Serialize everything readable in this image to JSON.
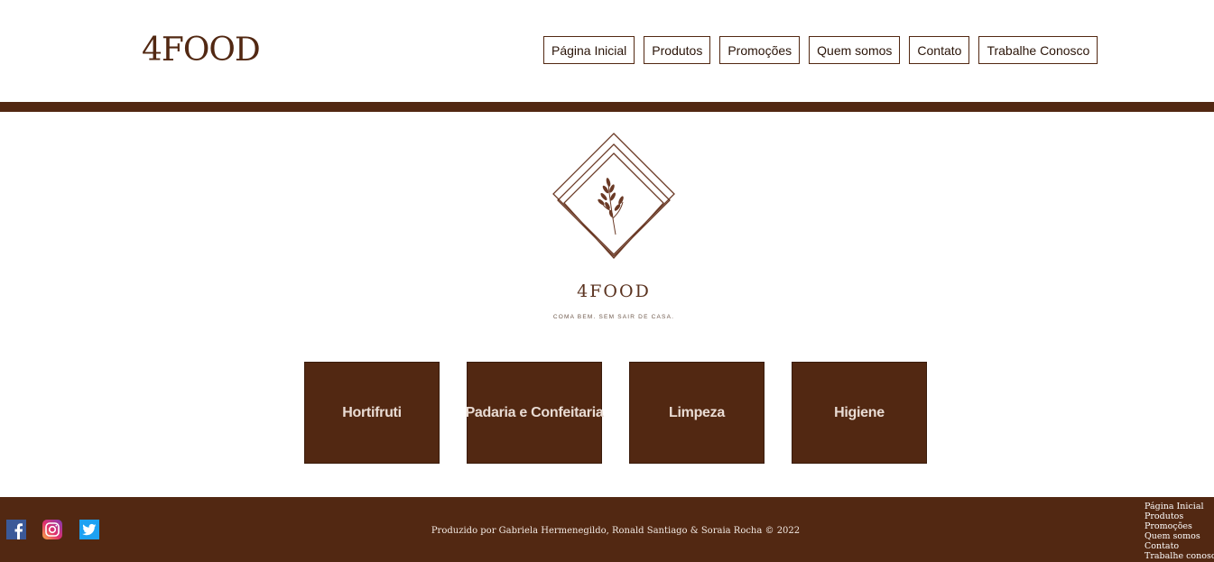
{
  "header": {
    "brand": "4FOOD",
    "nav": [
      "Página Inicial",
      "Produtos",
      "Promoções",
      "Quem somos",
      "Contato",
      "Trabalhe Conosco"
    ]
  },
  "hero_logo": {
    "name": "4FOOD",
    "tagline": "COMA BEM. SEM SAIR DE CASA."
  },
  "categories": [
    "Hortifruti",
    "Padaria e Confeitaria",
    "Limpeza",
    "Higiene"
  ],
  "footer": {
    "social_icons": [
      "facebook-icon",
      "instagram-icon",
      "twitter-icon"
    ],
    "credits": "Produzido por Gabriela Hermenegildo, Ronald Santiago & Soraia Rocha © 2022",
    "links": [
      "Página Inicial",
      "Produtos",
      "Promoções",
      "Quem somos",
      "Contato",
      "Trabalhe conosco"
    ]
  },
  "colors": {
    "brand_brown": "#522812",
    "footer_text": "#f1e8e2",
    "facebook": "#3b5998",
    "twitter": "#1da1f2"
  }
}
